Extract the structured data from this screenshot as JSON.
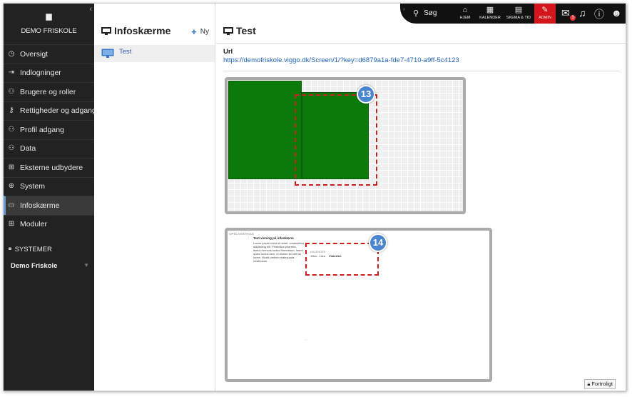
{
  "sidebar": {
    "school": "DEMO FRISKOLE",
    "items": [
      {
        "label": "Oversigt",
        "icon": "dashboard-icon"
      },
      {
        "label": "Indlogninger",
        "icon": "login-icon"
      },
      {
        "label": "Brugere og roller",
        "icon": "users-icon"
      },
      {
        "label": "Rettigheder og adgang",
        "icon": "key-icon"
      },
      {
        "label": "Profil adgang",
        "icon": "profile-users-icon"
      },
      {
        "label": "Data",
        "icon": "data-icon"
      },
      {
        "label": "Eksterne udbydere",
        "icon": "external-icon"
      },
      {
        "label": "System",
        "icon": "globe-icon"
      },
      {
        "label": "Infoskærme",
        "icon": "monitor-icon",
        "active": true
      },
      {
        "label": "Moduler",
        "icon": "modules-icon"
      }
    ],
    "systems_label": "SYSTEMER",
    "system_name": "Demo Friskole"
  },
  "list": {
    "title": "Infoskærme",
    "new_label": "Ny",
    "items": [
      {
        "label": "Test"
      }
    ]
  },
  "topbar": {
    "search": "Søg",
    "hjem": "HJEM",
    "kalender": "KALENDER",
    "skema": "SKEMA & TID",
    "admin": "ADMIN",
    "mail_badge": "3"
  },
  "main": {
    "title": "Test",
    "url_label": "Url",
    "url": "https://demofriskole.viggo.dk/Screen/1/?key=d6879a1a-fde7-4710-a9ff-5c4123"
  },
  "preview2": {
    "label": "OPSLAGSTAVLE",
    "title": "Test visning på infoskærm",
    "body": "Lorem ipsum dolor sit amet, consectetur adipiscing elit. Phasellus pharetra, lectus rhoncus luctus fermentum, lorem quam luctus sem, in dictum ex velit ac lorem. Morbi pretium malesuada vestibulum.",
    "calendar_label": "KALENDER",
    "time": "13ka - 14za",
    "event": "Vinterferi"
  },
  "callouts": {
    "first": "13",
    "second": "14"
  },
  "footer": {
    "confidential": "Fortroligt"
  },
  "colors": {
    "sidebar": "#222222",
    "accent_red": "#d4161c",
    "link": "#1f62b8",
    "green": "#0a7a0a",
    "callout_blue": "#4a86d0"
  }
}
